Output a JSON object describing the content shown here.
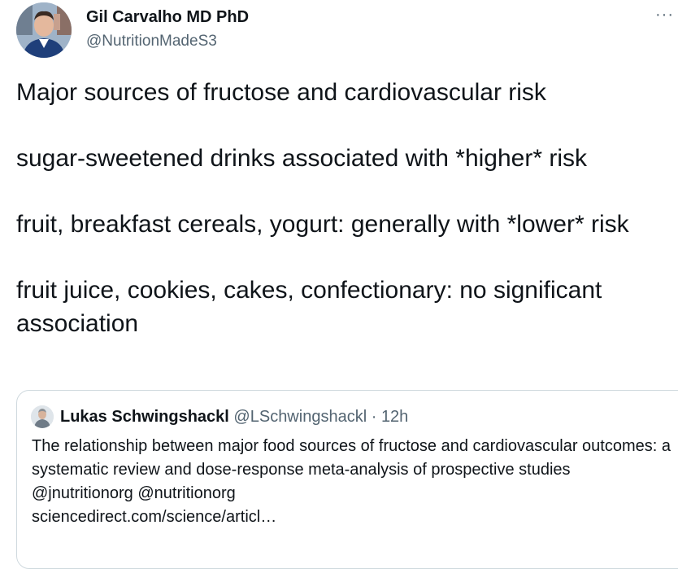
{
  "author": {
    "name": "Gil Carvalho MD PhD",
    "handle": "@NutritionMadeS3"
  },
  "more_label": "···",
  "tweet": {
    "paragraphs": [
      "Major sources of fructose and cardiovascular risk",
      "sugar-sweetened drinks associated with *higher* risk",
      "fruit, breakfast cereals, yogurt: generally with *lower* risk",
      "fruit juice, cookies, cakes, confectionary: no significant association"
    ]
  },
  "quote": {
    "name": "Lukas Schwingshackl",
    "handle": "@LSchwingshackl",
    "separator": "·",
    "time": "12h",
    "text": "The relationship between major food sources of fructose and cardiovascular outcomes: a systematic review and dose-response meta-analysis of prospective studies",
    "mentions": "@jnutritionorg @nutritionorg",
    "link": "sciencedirect.com/science/articl…"
  },
  "colors": {
    "text": "#0f1419",
    "secondary": "#536471",
    "border": "#cfd9de"
  }
}
